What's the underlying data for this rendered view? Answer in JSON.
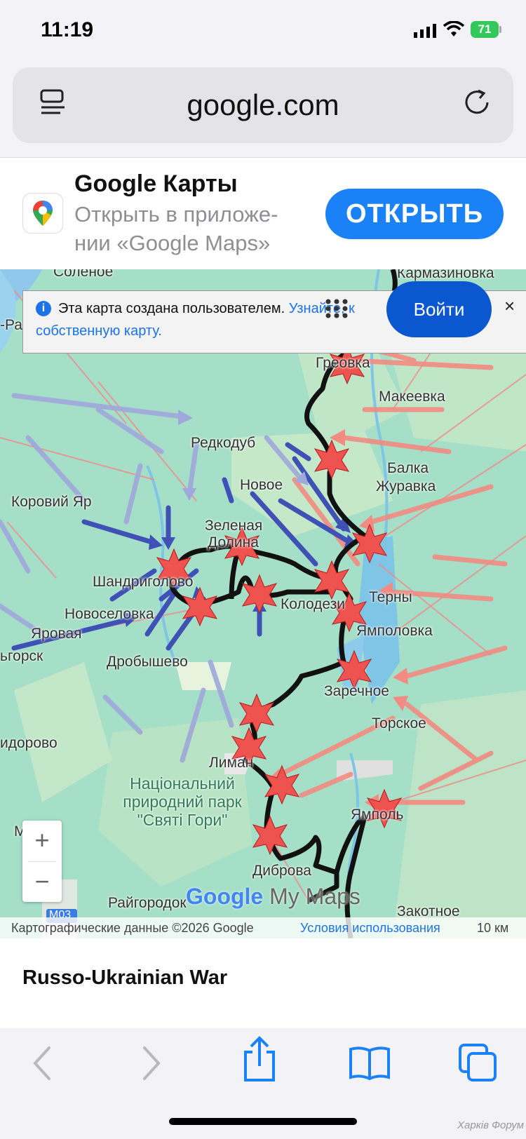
{
  "status_bar": {
    "time": "11:19",
    "battery": "71"
  },
  "browser": {
    "url": "google.com"
  },
  "app_banner": {
    "title": "Google Карты",
    "subtitle": "Открыть в приложе-нии «Google Maps»",
    "open_label": "ОТКРЫТЬ"
  },
  "map": {
    "info": {
      "text": "Эта карта создана пользователем.",
      "link": "Узнайте, к",
      "link2": "собственную карту.",
      "signin_label": "Войти",
      "close": "×"
    },
    "places": {
      "karmazinovka": "Кармазиновка",
      "solenoe": "Соленое",
      "ra": "-Ра",
      "grekovka": "Греовка",
      "makeevka": "Макеевка",
      "redkodub": "Редкодуб",
      "balka": "Балка",
      "zhuravka": "Журавка",
      "korovy": "Коровий Яр",
      "novoe": "Новое",
      "zelenaya": "Зеленая",
      "dolina": "Долина",
      "shandr": "Шандриголово",
      "terny": "Терны",
      "kolodezi": "Колодези",
      "novoselovka": "Новоселовка",
      "yampolovka": "Ямполовка",
      "yarovaya": "Яровая",
      "orsk": "ьгорск",
      "drobyshevo": "Дробышево",
      "zarechnoe": "Заречное",
      "torskoe": "Торское",
      "sidorovo": "идорово",
      "liman": "Лиман",
      "yampol": "Ямполь",
      "dibrova": "Диброва",
      "raigorodok": "Райгородок",
      "zakotnoe": "Закотное",
      "m": "М",
      "road": "М03"
    },
    "park": "Національний природний парк \"Святі Гори\"",
    "zoom_in": "+",
    "zoom_out": "−",
    "logo_google": "Google",
    "logo_mymaps": "My Maps",
    "attribution": "Картографические данные ©2026 Google",
    "terms": "Условия использования",
    "scale": "10 км"
  },
  "caption": "Russo-Ukrainian War",
  "watermark": "Харків Форум",
  "colors": {
    "accent": "#1a82f6",
    "front_line": "#111111",
    "blue_arrows": "#3f51b5",
    "red_arrows": "#f28b82",
    "stars": "#ef5350"
  }
}
